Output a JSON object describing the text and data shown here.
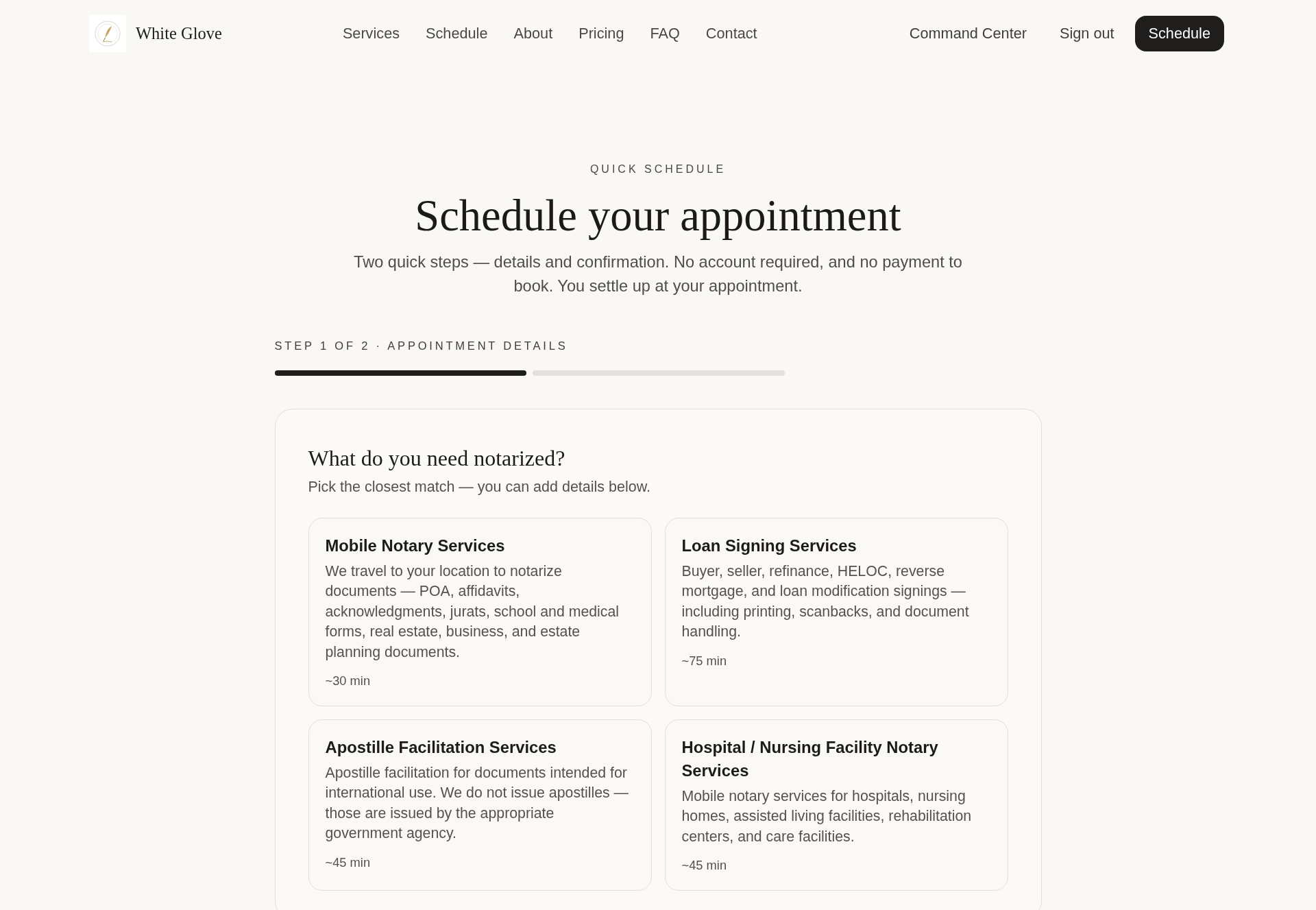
{
  "header": {
    "brand": "White Glove",
    "nav": [
      "Services",
      "Schedule",
      "About",
      "Pricing",
      "FAQ",
      "Contact"
    ],
    "actions": [
      {
        "label": "Command Center",
        "kind": "link"
      },
      {
        "label": "Sign out",
        "kind": "link"
      },
      {
        "label": "Schedule",
        "kind": "primary"
      }
    ]
  },
  "hero": {
    "eyebrow": "QUICK SCHEDULE",
    "title": "Schedule your appointment",
    "subtitle": "Two quick steps — details and confirmation. No account required, and no payment to book. You settle up at your appointment."
  },
  "step": {
    "label": "STEP 1 OF 2 · APPOINTMENT DETAILS",
    "segments": [
      {
        "done": true
      },
      {
        "done": false
      }
    ]
  },
  "form": {
    "heading": "What do you need notarized?",
    "hint": "Pick the closest match — you can add details below.",
    "options": [
      {
        "title": "Mobile Notary Services",
        "description": "We travel to your location to notarize documents — POA, affidavits, acknowledgments, jurats, school and medical forms, real estate, business, and estate planning documents.",
        "duration": "~30 min",
        "selected": false
      },
      {
        "title": "Loan Signing Services",
        "description": "Buyer, seller, refinance, HELOC, reverse mortgage, and loan modification signings — including printing, scanbacks, and document handling.",
        "duration": "~75 min",
        "selected": false
      },
      {
        "title": "Apostille Facilitation Services",
        "description": "Apostille facilitation for documents intended for international use. We do not issue apostilles — those are issued by the appropriate government agency.",
        "duration": "~45 min",
        "selected": false
      },
      {
        "title": "Hospital / Nursing Facility Notary Services",
        "description": "Mobile notary services for hospitals, nursing homes, assisted living facilities, rehabilitation centers, and care facilities.",
        "duration": "~45 min",
        "selected": false
      }
    ]
  }
}
